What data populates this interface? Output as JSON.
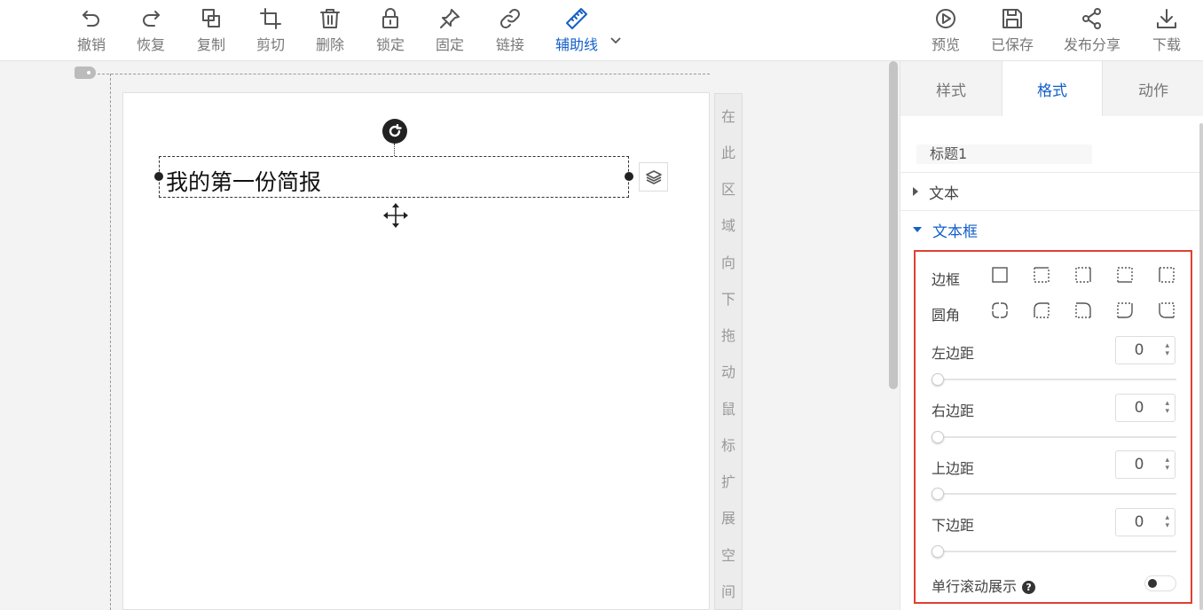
{
  "toolbar": {
    "left_buttons": [
      {
        "label": "撤销",
        "icon": "undo-icon"
      },
      {
        "label": "恢复",
        "icon": "redo-icon"
      },
      {
        "label": "复制",
        "icon": "copy-icon"
      },
      {
        "label": "剪切",
        "icon": "crop-icon"
      },
      {
        "label": "删除",
        "icon": "trash-icon"
      },
      {
        "label": "锁定",
        "icon": "lock-icon"
      },
      {
        "label": "固定",
        "icon": "pin-icon"
      },
      {
        "label": "链接",
        "icon": "link-icon"
      },
      {
        "label": "辅助线",
        "icon": "ruler-icon",
        "active": true
      }
    ],
    "right_buttons": [
      {
        "label": "预览",
        "icon": "play-icon"
      },
      {
        "label": "已保存",
        "icon": "save-icon"
      },
      {
        "label": "发布分享",
        "icon": "share-icon"
      },
      {
        "label": "下载",
        "icon": "download-icon"
      }
    ],
    "accent_color": "#1460c8"
  },
  "canvas": {
    "selected_text": "我的第一份简报",
    "drag_strip_chars": [
      "在",
      "此",
      "区",
      "域",
      "向",
      "下",
      "拖",
      "动",
      "鼠",
      "标",
      "扩",
      "展",
      "空",
      "间"
    ]
  },
  "panel": {
    "tabs": [
      {
        "label": "样式",
        "active": false
      },
      {
        "label": "格式",
        "active": true
      },
      {
        "label": "动作",
        "active": false
      }
    ],
    "title_value": "标题1",
    "sections": [
      {
        "label": "文本",
        "open": false
      },
      {
        "label": "文本框",
        "open": true
      }
    ],
    "textbox": {
      "border_label": "边框",
      "radius_label": "圆角",
      "paddings": [
        {
          "label": "左边距",
          "value": "0"
        },
        {
          "label": "右边距",
          "value": "0"
        },
        {
          "label": "上边距",
          "value": "0"
        },
        {
          "label": "下边距",
          "value": "0"
        }
      ],
      "scroll_label": "单行滚动展示",
      "help_glyph": "?"
    },
    "highlight_color": "#e04030"
  }
}
